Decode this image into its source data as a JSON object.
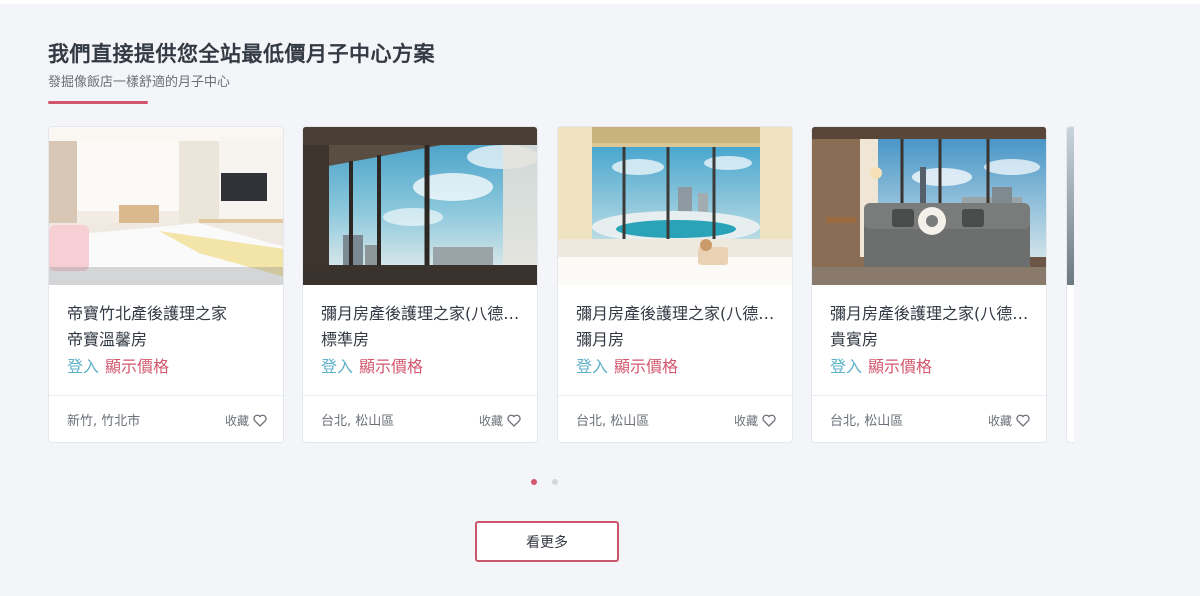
{
  "section": {
    "title": "我們直接提供您全站最低價月子中心方案",
    "subtitle": "發掘像飯店一樣舒適的月子中心"
  },
  "cards": [
    {
      "name": "帝寶竹北產後護理之家",
      "room_type": "帝寶溫馨房",
      "login_label": "登入",
      "price_label": "顯示價格",
      "location": "新竹, 竹北市",
      "favorite_label": "收藏",
      "photo_icon": "bedroom-photo"
    },
    {
      "name": "彌月房產後護理之家(八德館)",
      "room_type": "標準房",
      "login_label": "登入",
      "price_label": "顯示價格",
      "location": "台北, 松山區",
      "favorite_label": "收藏",
      "photo_icon": "window-view-photo"
    },
    {
      "name": "彌月房產後護理之家(八德館)",
      "room_type": "彌月房",
      "login_label": "登入",
      "price_label": "顯示價格",
      "location": "台北, 松山區",
      "favorite_label": "收藏",
      "photo_icon": "stadium-view-photo"
    },
    {
      "name": "彌月房產後護理之家(八德館)",
      "room_type": "貴賓房",
      "login_label": "登入",
      "price_label": "顯示價格",
      "location": "台北, 松山區",
      "favorite_label": "收藏",
      "photo_icon": "sofa-room-photo"
    }
  ],
  "pagination": {
    "total": 2,
    "active": 1
  },
  "more_button": {
    "label": "看更多"
  },
  "colors": {
    "accent": "#d2566d",
    "login": "#5fb1c9",
    "text": "#333a44",
    "muted": "#6b7079",
    "background": "#f3f5f8"
  }
}
